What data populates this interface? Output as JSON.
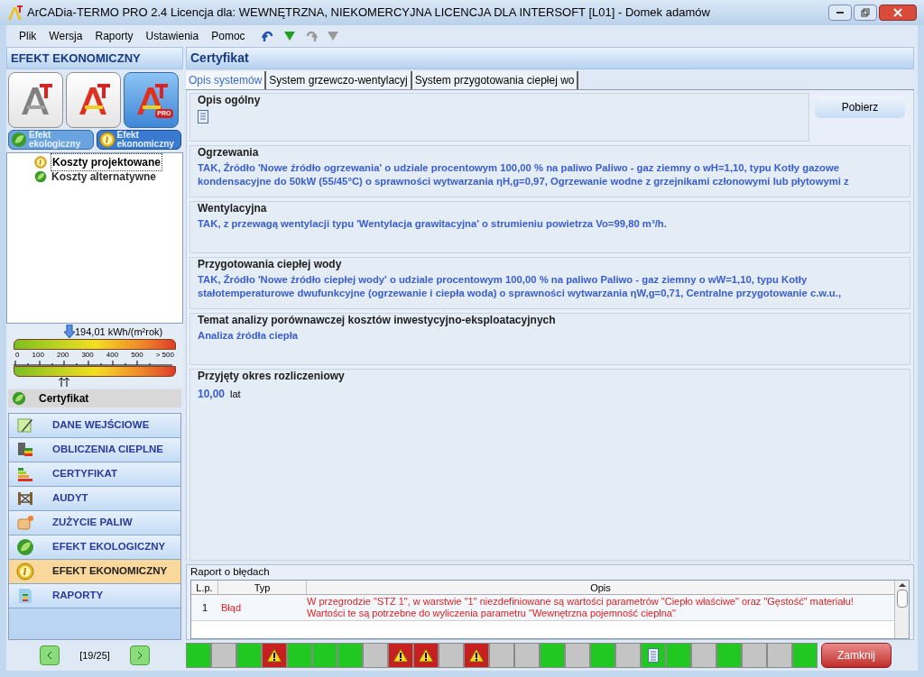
{
  "window": {
    "title": "ArCADia-TERMO PRO 2.4 Licencja dla: WEWNĘTRZNA, NIEKOMERCYJNA LICENCJA DLA INTERSOFT [L01] - Domek adamów"
  },
  "menu": [
    {
      "label": "Plik"
    },
    {
      "label": "Wersja"
    },
    {
      "label": "Raporty"
    },
    {
      "label": "Ustawienia"
    },
    {
      "label": "Pomoc"
    }
  ],
  "toolbar": [
    {
      "kind": "undo",
      "disabled": false
    },
    {
      "kind": "down",
      "disabled": false
    },
    {
      "kind": "redo",
      "disabled": true
    },
    {
      "kind": "down",
      "disabled": true
    }
  ],
  "sidebar": {
    "title": "EFEKT EKONOMICZNY",
    "logos": [
      {
        "kind": "flat",
        "selected": false
      },
      {
        "kind": "color",
        "selected": false
      },
      {
        "kind": "pro",
        "selected": true,
        "badge": "PRO"
      }
    ],
    "toggles": [
      {
        "label": "Efekt ekologiczny",
        "kind": "leaf",
        "selected": false
      },
      {
        "label": "Efekt ekonomiczny",
        "kind": "coin",
        "selected": true
      }
    ],
    "tree": [
      {
        "label": "Koszty projektowane",
        "kind": "coin",
        "selected": true
      },
      {
        "label": "Koszty alternatywne",
        "kind": "leaf",
        "selected": false
      }
    ],
    "gauge": {
      "reading": "194,01 kWh/(m²rok)",
      "ticks": [
        "0",
        "100",
        "200",
        "300",
        "400",
        "500",
        "> 500"
      ]
    },
    "section": "Certyfikat",
    "items": [
      {
        "label": "DANE WEJŚCIOWE",
        "kind": "pen",
        "selected": false
      },
      {
        "label": "OBLICZENIA CIEPLNE",
        "kind": "calc",
        "selected": false
      },
      {
        "label": "CERTYFIKAT",
        "kind": "bars",
        "selected": false
      },
      {
        "label": "AUDYT",
        "kind": "audit",
        "selected": false
      },
      {
        "label": "ZUŻYCIE PALIW",
        "kind": "fuel",
        "selected": false
      },
      {
        "label": "EFEKT EKOLOGICZNY",
        "kind": "leaf",
        "selected": false
      },
      {
        "label": "EFEKT EKONOMICZNY",
        "kind": "coin",
        "selected": true
      },
      {
        "label": "RAPORTY",
        "kind": "report",
        "selected": false
      }
    ],
    "pager": "[19/25]"
  },
  "panel": {
    "title": "Certyfikat",
    "tabs": [
      {
        "label": "Opis systemów",
        "selected": true
      },
      {
        "label": "System grzewczo-wentylacyj",
        "selected": false
      },
      {
        "label": "System przygotowania ciepłej wo",
        "selected": false
      }
    ],
    "general": {
      "title": "Opis ogólny",
      "button": "Pobierz"
    },
    "groups": [
      {
        "title": "Ogrzewania",
        "text": "TAK, Źródło 'Nowe źródło ogrzewania' o udziale procentowym 100,00 % na paliwo Paliwo - gaz ziemny o wH=1,10, typu Kotły gazowe kondensacyjne do 50kW (55/45°C) o sprawności wytwarzania ηH,g=0,97, Ogrzewanie wodne z grzejnikami członowymi lub płytowymi z"
      },
      {
        "title": "Wentylacyjna",
        "text": "TAK, z przewagą wentylacji typu 'Wentylacja grawitacyjna' o strumieniu powietrza Vo=99,80 m³/h."
      },
      {
        "title": "Przygotowania ciepłej wody",
        "text": "TAK, Źródło 'Nowe źródło ciepłej wody' o udziale procentowym 100,00 % na paliwo Paliwo - gaz ziemny o wW=1,10, typu Kotły stałotemperaturowe dwufunkcyjne (ogrzewanie i ciepła woda) o sprawności wytwarzania ηW,g=0,71, Centralne przygotowanie c.w.u.,"
      },
      {
        "title": "Temat analizy porównawczej kosztów inwestycyjno-eksploatacyjnych",
        "text": "Analiza źródła ciepła"
      }
    ],
    "period": {
      "title": "Przyjęty okres rozliczeniowy",
      "value": "10,00",
      "unit": "lat"
    }
  },
  "errors": {
    "title": "Raport o błędach",
    "columns": [
      "L.p.",
      "Typ",
      "Opis"
    ],
    "rows": [
      {
        "lp": "1",
        "type": "Błąd",
        "text": "W przegrodzie \"STZ 1\", w warstwie \"1\" niezdefiniowane są wartości parametrów \"Ciepło właściwe\" oraz \"Gęstość\" materiału! Wartości te są potrzebne do wyliczenia parametru \"Wewnętrzna pojemność cieplna\""
      }
    ]
  },
  "status_cells": [
    {
      "kind": "ok"
    },
    {
      "kind": "empty"
    },
    {
      "kind": "ok"
    },
    {
      "kind": "warning"
    },
    {
      "kind": "ok"
    },
    {
      "kind": "ok"
    },
    {
      "kind": "ok"
    },
    {
      "kind": "empty"
    },
    {
      "kind": "warning"
    },
    {
      "kind": "warning"
    },
    {
      "kind": "empty"
    },
    {
      "kind": "warning"
    },
    {
      "kind": "empty"
    },
    {
      "kind": "empty"
    },
    {
      "kind": "ok"
    },
    {
      "kind": "empty"
    },
    {
      "kind": "ok"
    },
    {
      "kind": "empty"
    },
    {
      "kind": "document"
    },
    {
      "kind": "ok"
    },
    {
      "kind": "empty"
    },
    {
      "kind": "ok"
    },
    {
      "kind": "empty"
    },
    {
      "kind": "empty"
    },
    {
      "kind": "ok"
    }
  ],
  "close_button": "Zamknij"
}
